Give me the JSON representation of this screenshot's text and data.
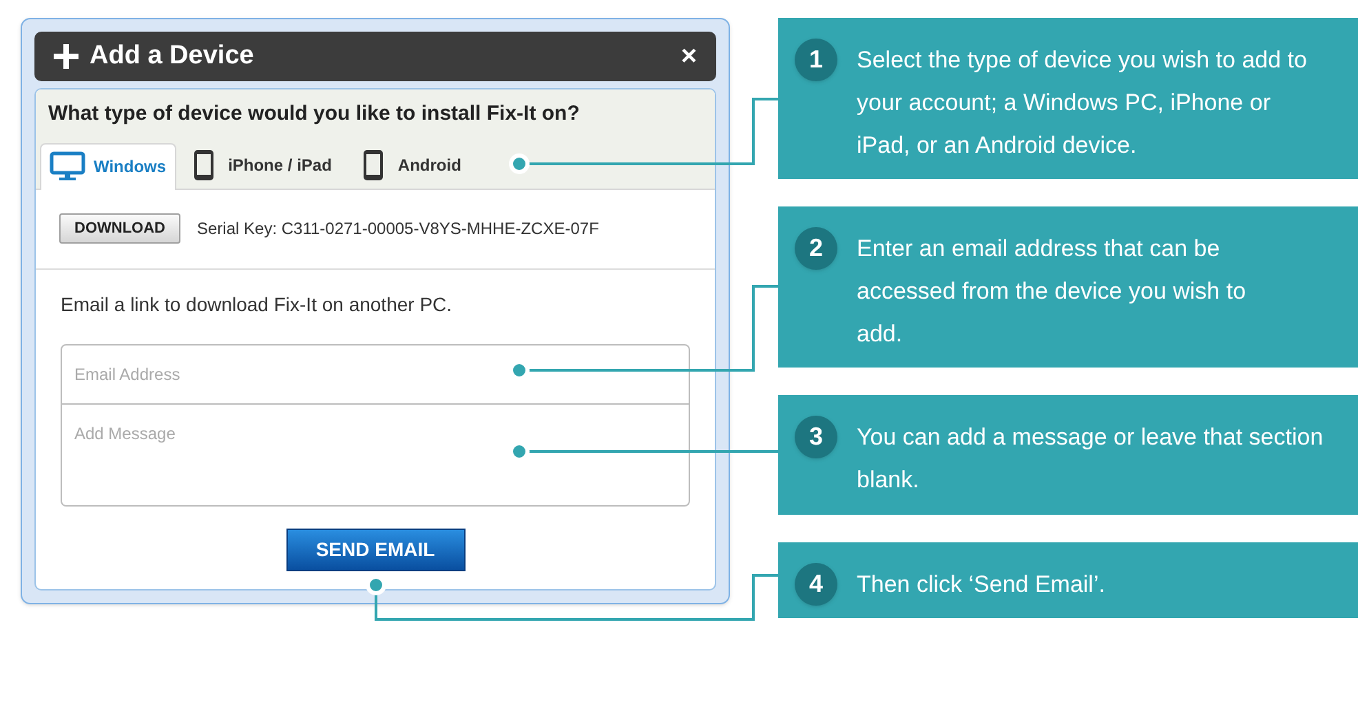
{
  "dialog": {
    "title": "Add a Device",
    "close": "×",
    "question": "What type of device would you like to install Fix-It on?",
    "tabs": [
      {
        "label": "Windows",
        "selected": true,
        "kind": "monitor"
      },
      {
        "label": "iPhone / iPad",
        "selected": false,
        "kind": "phone"
      },
      {
        "label": "Android",
        "selected": false,
        "kind": "phone"
      }
    ],
    "download_button": "DOWNLOAD",
    "serial_key": "Serial Key: C311-0271-00005-V8YS-MHHE-ZCXE-07F",
    "email_prompt": "Email a link to download Fix-It on another PC.",
    "email_field": {
      "placeholder": "Email Address"
    },
    "message_field": {
      "placeholder": "Add Message"
    },
    "send_button": "SEND EMAIL"
  },
  "callouts": [
    {
      "number": "1",
      "text": "Select the type of device you wish to add to your account; a Windows PC, iPhone or iPad, or an Android device."
    },
    {
      "number": "2",
      "text": "Enter an email address that can be accessed from the device you wish to add."
    },
    {
      "number": "3",
      "text": "You can add a message or leave that section blank."
    },
    {
      "number": "4",
      "text": "Then click ‘Send Email’."
    }
  ]
}
